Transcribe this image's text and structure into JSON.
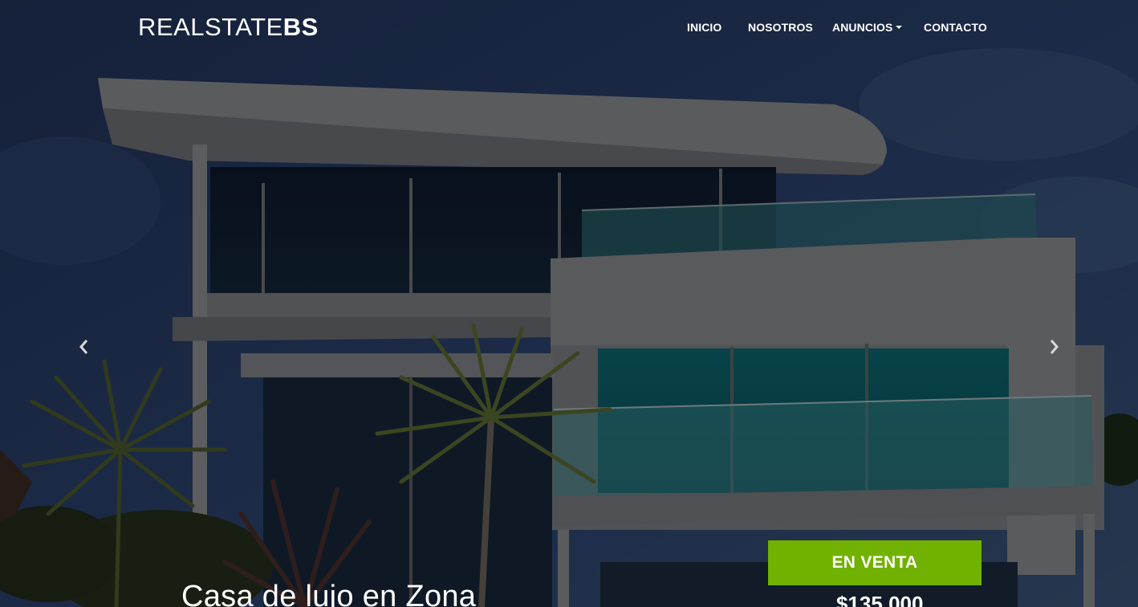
{
  "brand": {
    "light": "REALSTATE",
    "bold": "BS"
  },
  "nav": {
    "inicio": "INICIO",
    "nosotros": "NOSOTROS",
    "anuncios": "ANUNCIOS",
    "contacto": "CONTACTO"
  },
  "carousel": {
    "prev_icon": "chevron-left-icon",
    "next_icon": "chevron-right-icon",
    "slide": {
      "title": "Casa de lujo en Zona",
      "status": "EN VENTA",
      "price": "$135,000"
    }
  },
  "colors": {
    "accent": "#71b100",
    "text": "#ffffff"
  }
}
